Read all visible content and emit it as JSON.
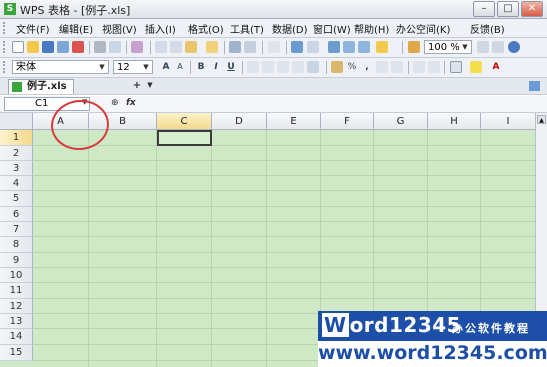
{
  "window": {
    "title": "WPS 表格 - [例子.xls]",
    "app_icon_letter": "S",
    "controls": [
      "–",
      "□",
      "✕"
    ]
  },
  "menu": {
    "items": [
      "文件(F)",
      "编辑(E)",
      "视图(V)",
      "插入(I)",
      "格式(O)",
      "工具(T)",
      "数据(D)",
      "窗口(W)",
      "帮助(H)",
      "办公空间(K)",
      "反馈(B)"
    ]
  },
  "toolbar1": {
    "icons": [
      "new-icon",
      "open-icon",
      "save-icon",
      "email-icon",
      "pdf-icon",
      "print-icon",
      "preview-icon",
      "spellcheck-icon",
      "cut-icon",
      "copy-icon",
      "paste-icon",
      "format-painter-icon",
      "undo-icon",
      "redo-icon",
      "insert-row-icon",
      "sort-asc-icon",
      "autosum-icon",
      "sort-desc-icon",
      "filter-icon",
      "chart-icon",
      "find-icon",
      "zoom-icon",
      "help-icon"
    ],
    "zoom_value": "100 %"
  },
  "toolbar2": {
    "font_name": "宋体",
    "font_size": "12",
    "buttons": [
      "A",
      "A",
      "B",
      "I",
      "U"
    ]
  },
  "tabs": {
    "document": "例子.xls",
    "add_label": "+"
  },
  "formula_bar": {
    "cell_ref": "C1",
    "fx_label": "fx"
  },
  "sheet": {
    "columns": [
      "A",
      "B",
      "C",
      "D",
      "E",
      "F",
      "G",
      "H",
      "I"
    ],
    "rows": [
      "1",
      "2",
      "3",
      "4",
      "5",
      "6",
      "7",
      "8",
      "9",
      "10",
      "11",
      "12",
      "13",
      "14",
      "15"
    ],
    "selected_cell": "C1",
    "highlight_color": "#d83a3a",
    "grid_bg": "#cfe8c6"
  },
  "watermark": {
    "logo_w": "W",
    "logo_rest": "ord12345",
    "subtitle": "办公软件教程",
    "url": "www.word12345.com"
  }
}
